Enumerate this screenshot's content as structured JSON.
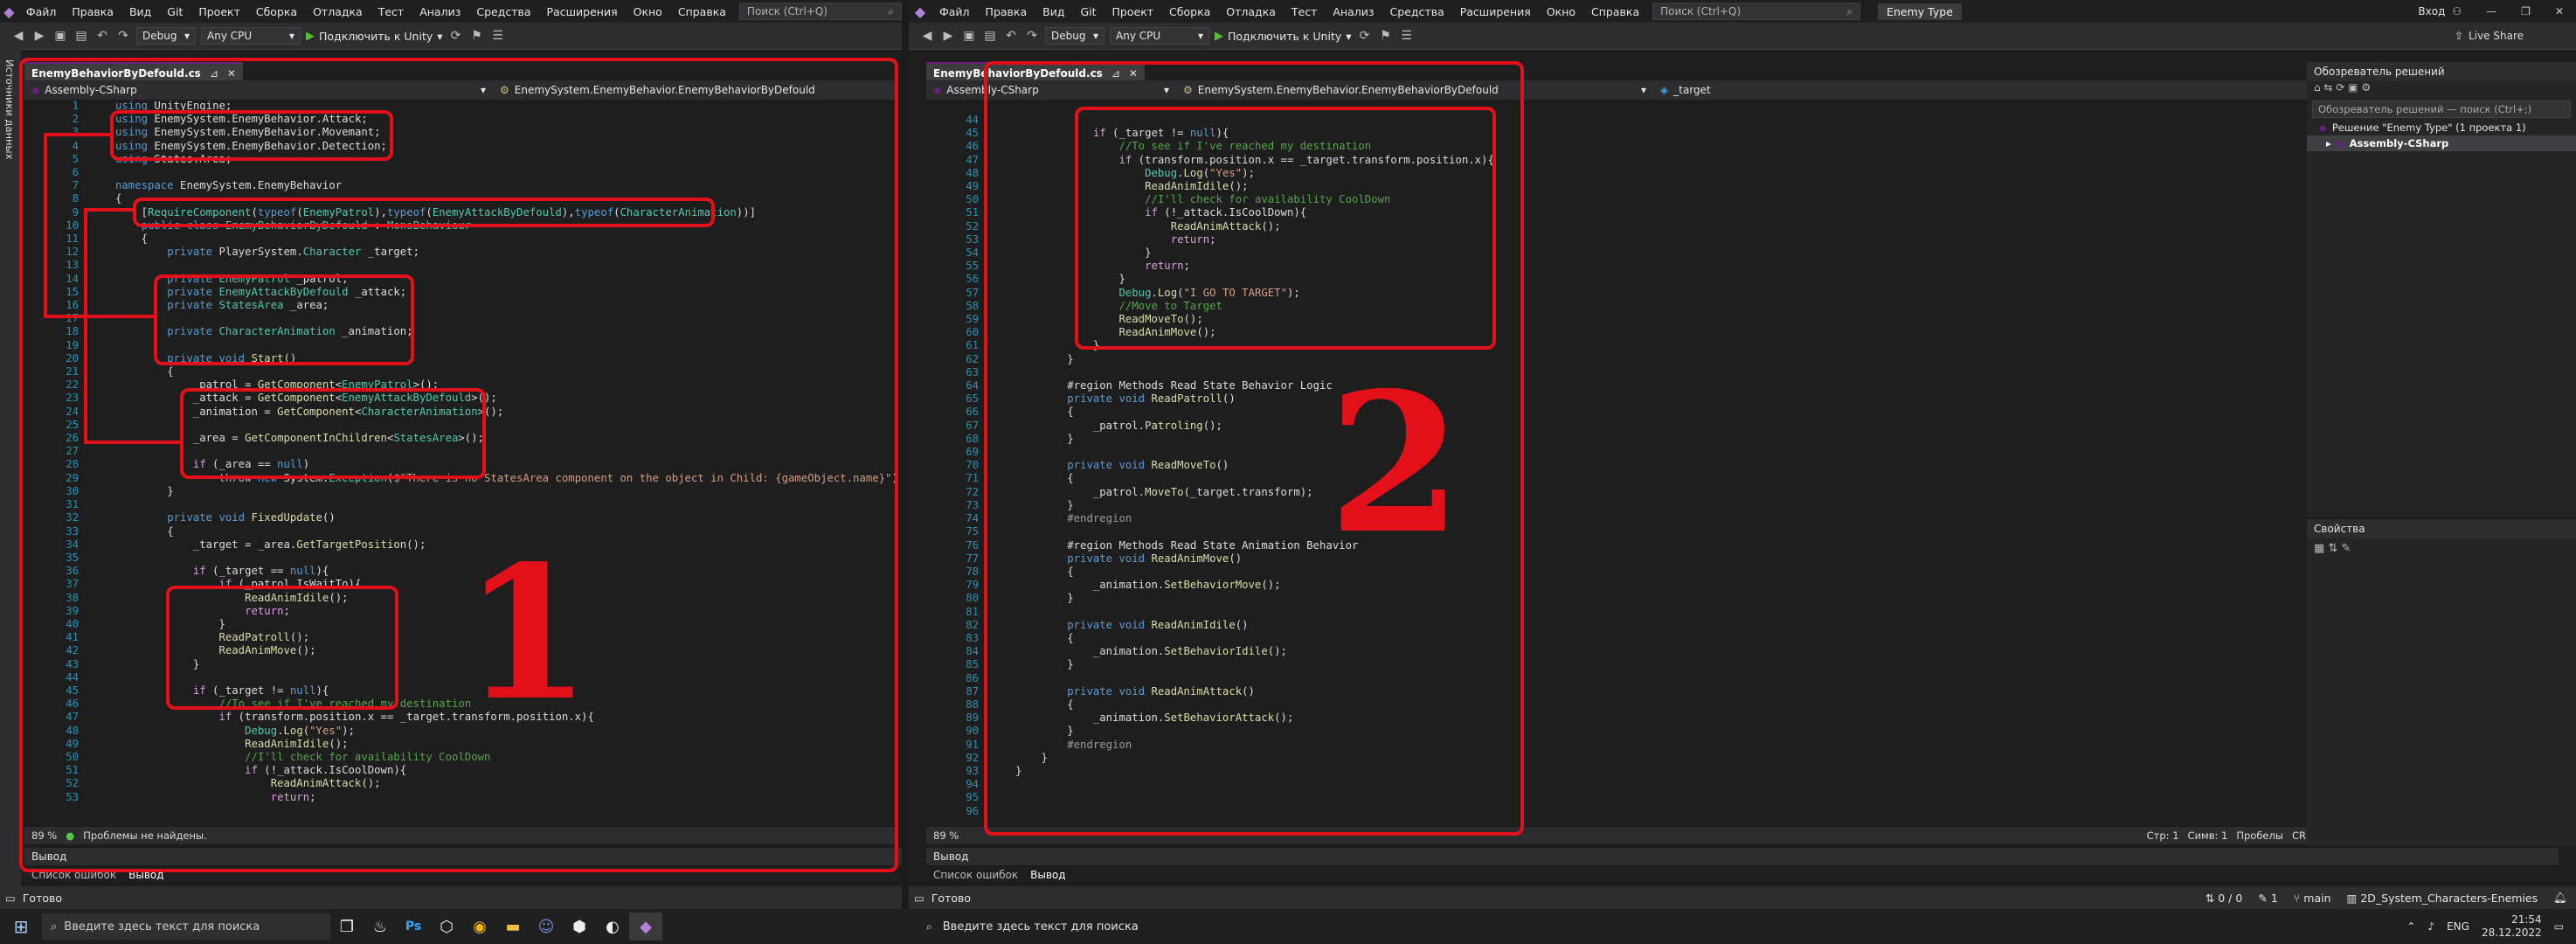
{
  "left": {
    "menu": [
      "Файл",
      "Правка",
      "Вид",
      "Git",
      "Проект",
      "Сборка",
      "Отладка",
      "Тест",
      "Анализ",
      "Средства",
      "Расширения",
      "Окно",
      "Справка"
    ],
    "search_placeholder": "Поиск (Ctrl+Q)",
    "config": "Debug",
    "platform": "Any CPU",
    "run_label": "Подключить к Unity",
    "tab_title": "EnemyBehaviorByDefould.cs",
    "nav_project": "Assembly-CSharp",
    "nav_class": "EnemySystem.EnemyBehavior.EnemyBehaviorByDefould",
    "side_tab": "Источники данных",
    "zoom": "89 %",
    "problems": "Проблемы не найдены.",
    "output_header": "Вывод",
    "bottom_tabs": [
      "Список ошибок",
      "Вывод"
    ],
    "app_status": "Готово",
    "big_number": "1"
  },
  "right": {
    "menu": [
      "Файл",
      "Правка",
      "Вид",
      "Git",
      "Проект",
      "Сборка",
      "Отладка",
      "Тест",
      "Анализ",
      "Средства",
      "Расширения",
      "Окно",
      "Справка"
    ],
    "search_placeholder": "Поиск (Ctrl+Q)",
    "solution_tag": "Enemy Type",
    "login": "Вход",
    "live_share": "Live Share",
    "config": "Debug",
    "platform": "Any CPU",
    "run_label": "Подключить к Unity",
    "tab_title": "EnemyBehaviorByDefould.cs",
    "nav_project": "Assembly-CSharp",
    "nav_class": "EnemySystem.EnemyBehavior.EnemyBehaviorByDefould",
    "nav_member": "_target",
    "zoom": "89 %",
    "status_line": "Стр: 1",
    "status_col": "Симв: 1",
    "status_ws": "Пробелы",
    "status_eol": "CRLF",
    "output_header": "Вывод",
    "bottom_tabs": [
      "Список ошибок",
      "Вывод"
    ],
    "app_status": "Готово",
    "git_changes": "0 / 0",
    "git_pushes": "1",
    "git_branch": "main",
    "repo": "2D_System_Characters-Enemies",
    "big_number": "2",
    "solution_explorer": {
      "title": "Обозреватель решений",
      "search": "Обозреватель решений — поиск (Ctrl+;)",
      "solution": "Решение \"Enemy Type\" (1 проекта 1)",
      "project": "Assembly-CSharp"
    },
    "properties_title": "Свойства"
  },
  "taskbar": {
    "search_placeholder": "Введите здесь текст для поиска",
    "language": "ENG",
    "time": "21:54",
    "date": "28.12.2022"
  }
}
